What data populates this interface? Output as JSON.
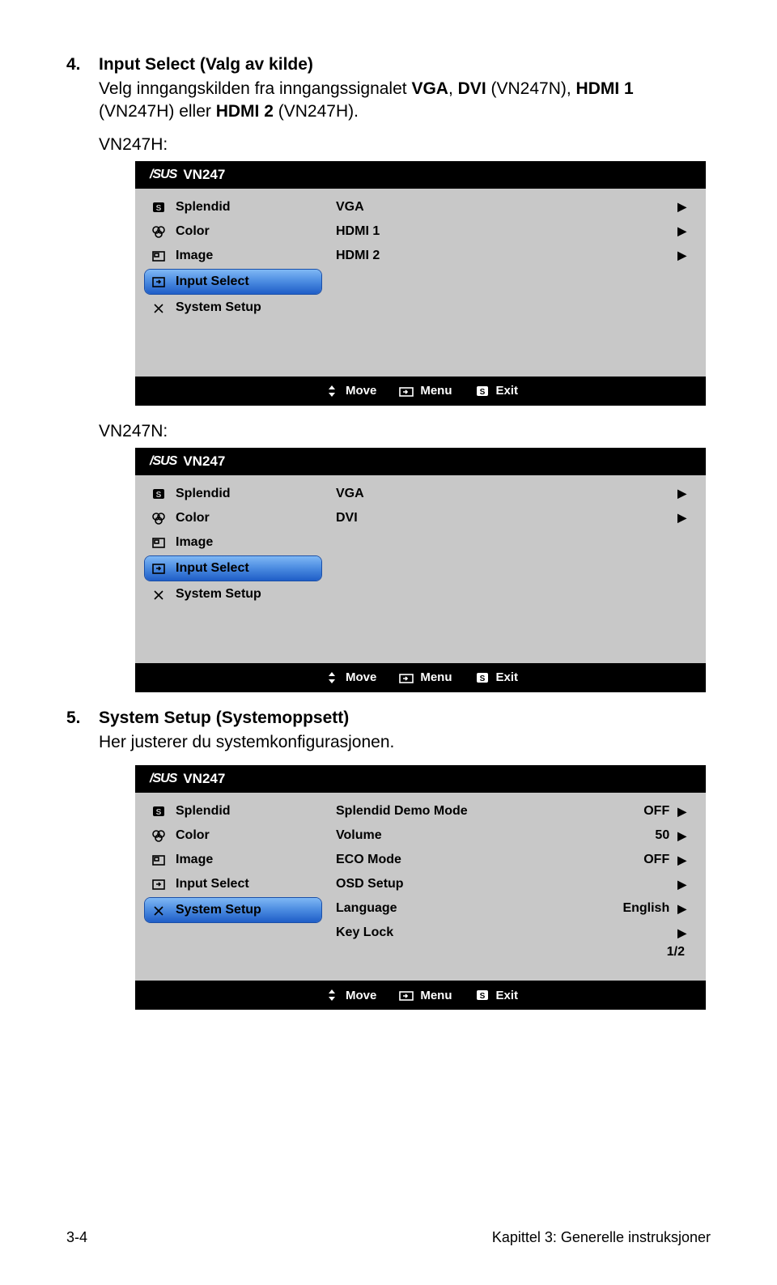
{
  "section4": {
    "num": "4.",
    "title": "Input Select (Valg av kilde)",
    "body": "Velg inngangskilden fra inngangssignalet VGA, DVI (VN247N), HDMI 1 (VN247H) eller HDMI 2 (VN247H).",
    "label_h": "VN247H:",
    "label_n": "VN247N:"
  },
  "section5": {
    "num": "5.",
    "title": "System Setup (Systemoppsett)",
    "body": "Her justerer du systemkonfigurasjonen."
  },
  "osd_common": {
    "brand": "/SUS",
    "model": "VN247",
    "menu_splendid": "Splendid",
    "menu_color": "Color",
    "menu_image": "Image",
    "menu_input": "Input Select",
    "menu_system": "System Setup",
    "foot_move": "Move",
    "foot_menu": "Menu",
    "foot_exit": "Exit"
  },
  "osd1": {
    "options": [
      {
        "label": "VGA"
      },
      {
        "label": "HDMI 1"
      },
      {
        "label": "HDMI 2"
      }
    ]
  },
  "osd2": {
    "options": [
      {
        "label": "VGA"
      },
      {
        "label": "DVI"
      }
    ]
  },
  "osd3": {
    "options": [
      {
        "label": "Splendid Demo Mode",
        "value": "OFF"
      },
      {
        "label": "Volume",
        "value": "50"
      },
      {
        "label": "ECO Mode",
        "value": "OFF"
      },
      {
        "label": "OSD Setup",
        "value": ""
      },
      {
        "label": "Language",
        "value": "English"
      },
      {
        "label": "Key Lock",
        "value": ""
      }
    ],
    "page": "1/2"
  },
  "footer": {
    "page_num": "3-4",
    "chapter": "Kapittel 3: Generelle instruksjoner"
  }
}
